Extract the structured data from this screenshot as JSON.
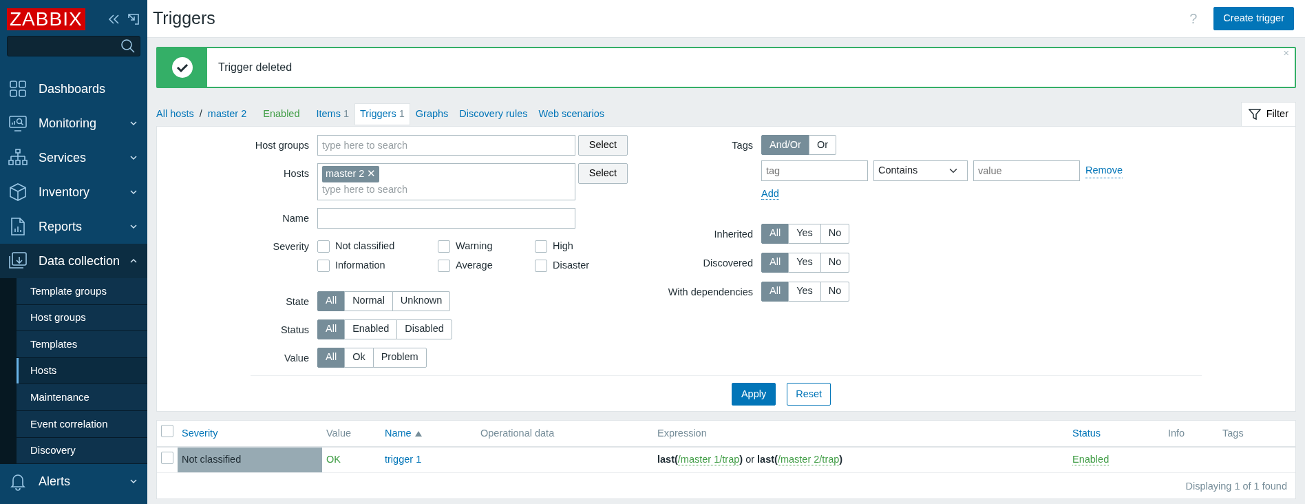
{
  "sidebar": {
    "logo": "ZABBIX",
    "menu": [
      {
        "label": "Dashboards",
        "expandable": false,
        "expanded": false
      },
      {
        "label": "Monitoring",
        "expandable": true,
        "expanded": false
      },
      {
        "label": "Services",
        "expandable": true,
        "expanded": false
      },
      {
        "label": "Inventory",
        "expandable": true,
        "expanded": false
      },
      {
        "label": "Reports",
        "expandable": true,
        "expanded": false
      },
      {
        "label": "Data collection",
        "expandable": true,
        "expanded": true,
        "children": [
          {
            "label": "Template groups",
            "selected": false
          },
          {
            "label": "Host groups",
            "selected": false
          },
          {
            "label": "Templates",
            "selected": false
          },
          {
            "label": "Hosts",
            "selected": true
          },
          {
            "label": "Maintenance",
            "selected": false
          },
          {
            "label": "Event correlation",
            "selected": false
          },
          {
            "label": "Discovery",
            "selected": false
          }
        ]
      },
      {
        "label": "Alerts",
        "expandable": true,
        "expanded": false
      }
    ]
  },
  "header": {
    "title": "Triggers",
    "help": "?",
    "button": "Create trigger"
  },
  "message": {
    "kind": "success",
    "text": "Trigger deleted",
    "close": "×"
  },
  "breadcrumbs": {
    "items": [
      "All hosts",
      "master 2"
    ],
    "separator": "/",
    "status": "Enabled"
  },
  "tabs": [
    {
      "label": "Items",
      "count": "1",
      "selected": false
    },
    {
      "label": "Triggers",
      "count": "1",
      "selected": true
    },
    {
      "label": "Graphs",
      "selected": false
    },
    {
      "label": "Discovery rules",
      "selected": false
    },
    {
      "label": "Web scenarios",
      "selected": false
    }
  ],
  "filter_tab": {
    "label": "Filter",
    "selected": true
  },
  "filter": {
    "host_groups": {
      "label": "Host groups",
      "placeholder": "type here to search",
      "button": "Select"
    },
    "hosts": {
      "label": "Hosts",
      "chips": [
        "master 2"
      ],
      "chip_remove": "✕",
      "placeholder": "type here to search",
      "button": "Select"
    },
    "name": {
      "label": "Name"
    },
    "severity": {
      "label": "Severity",
      "options": [
        {
          "label": "Not classified",
          "checked": false
        },
        {
          "label": "Warning",
          "checked": false
        },
        {
          "label": "High",
          "checked": false
        },
        {
          "label": "Information",
          "checked": false
        },
        {
          "label": "Average",
          "checked": false
        },
        {
          "label": "Disaster",
          "checked": false
        }
      ]
    },
    "segments_left": [
      {
        "label": "State",
        "options": [
          {
            "label": "All",
            "selected": true
          },
          {
            "label": "Normal",
            "selected": false
          },
          {
            "label": "Unknown",
            "selected": false
          }
        ]
      },
      {
        "label": "Status",
        "options": [
          {
            "label": "All",
            "selected": true
          },
          {
            "label": "Enabled",
            "selected": false
          },
          {
            "label": "Disabled",
            "selected": false
          }
        ]
      },
      {
        "label": "Value",
        "options": [
          {
            "label": "All",
            "selected": true
          },
          {
            "label": "Ok",
            "selected": false
          },
          {
            "label": "Problem",
            "selected": false
          }
        ]
      }
    ],
    "tags": {
      "label": "Tags",
      "operator": [
        {
          "label": "And/Or",
          "selected": true
        },
        {
          "label": "Or",
          "selected": false
        }
      ],
      "rows": [
        {
          "tag_placeholder": "tag",
          "operator": "Contains",
          "value_placeholder": "value",
          "remove": "Remove"
        }
      ],
      "add": "Add"
    },
    "segments_right": [
      {
        "label": "Inherited",
        "options": [
          {
            "label": "All",
            "selected": true
          },
          {
            "label": "Yes",
            "selected": false
          },
          {
            "label": "No",
            "selected": false
          }
        ]
      },
      {
        "label": "Discovered",
        "options": [
          {
            "label": "All",
            "selected": true
          },
          {
            "label": "Yes",
            "selected": false
          },
          {
            "label": "No",
            "selected": false
          }
        ]
      },
      {
        "label": "With dependencies",
        "options": [
          {
            "label": "All",
            "selected": true
          },
          {
            "label": "Yes",
            "selected": false
          },
          {
            "label": "No",
            "selected": false
          }
        ]
      }
    ],
    "apply": "Apply",
    "reset": "Reset"
  },
  "table": {
    "all_checked": false,
    "columns": [
      {
        "label": "Severity",
        "link": true,
        "sorted": false
      },
      {
        "label": "Value",
        "link": false,
        "sorted": false
      },
      {
        "label": "Name",
        "link": true,
        "sorted": true
      },
      {
        "label": "Operational data",
        "link": false,
        "sorted": false
      },
      {
        "label": "Expression",
        "link": false,
        "sorted": false
      },
      {
        "label": "Status",
        "link": true,
        "sorted": false
      },
      {
        "label": "Info",
        "link": false,
        "sorted": false
      },
      {
        "label": "Tags",
        "link": false,
        "sorted": false
      }
    ],
    "rows": [
      {
        "checked": false,
        "severity": "Not classified",
        "color": "#97aab3",
        "value": "OK",
        "name": "trigger 1",
        "expression": [
          {
            "kind": "func",
            "text": "last("
          },
          {
            "kind": "ref",
            "text": "/master 1/trap"
          },
          {
            "kind": "func",
            "text": ")"
          },
          {
            "kind": "text",
            "text": " or "
          },
          {
            "kind": "func",
            "text": "last("
          },
          {
            "kind": "ref",
            "text": "/master 2/trap"
          },
          {
            "kind": "func",
            "text": ")"
          }
        ],
        "status": "Enabled"
      }
    ],
    "footer": "Displaying 1 of 1 found"
  }
}
